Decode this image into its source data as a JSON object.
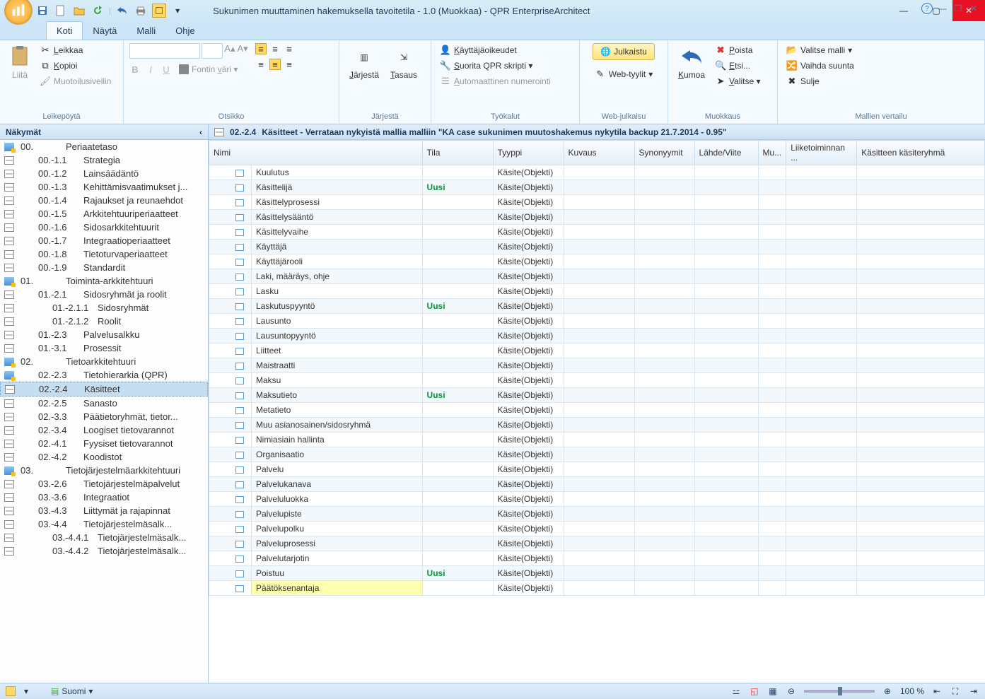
{
  "window": {
    "title": "Sukunimen muuttaminen hakemuksella tavoitetila - 1.0 (Muokkaa) - QPR EnterpriseArchitect"
  },
  "ribbon_tabs": [
    "Koti",
    "Näytä",
    "Malli",
    "Ohje"
  ],
  "ribbon": {
    "group_clipboard": {
      "label": "Leikepöytä",
      "paste": "Liitä",
      "cut": "Leikkaa",
      "copy": "Kopioi",
      "fmt": "Muotoilusivellin"
    },
    "group_title": {
      "label": "Otsikko",
      "fontcolor": "Fontin väri"
    },
    "group_arrange": {
      "label": "Järjestä",
      "sort": "Järjestä",
      "align": "Tasaus"
    },
    "group_tools": {
      "label": "Työkalut",
      "perm": "Käyttäjäoikeudet",
      "script": "Suorita QPR skripti",
      "autonum": "Automaattinen numerointi"
    },
    "group_web": {
      "label": "Web-julkaisu",
      "publish": "Julkaistu",
      "styles": "Web-tyylit"
    },
    "group_edit": {
      "label": "Muokkaus",
      "undo": "Kumoa",
      "delete": "Poista",
      "find": "Etsi...",
      "select": "Valitse"
    },
    "group_compare": {
      "label": "Mallien vertailu",
      "choose": "Valitse malli",
      "dir": "Vaihda suunta",
      "close": "Sulje"
    }
  },
  "nav": {
    "title": "Näkymät",
    "items": [
      {
        "icon": "folder",
        "code": "00.",
        "label": "Periaatetaso",
        "lvl": 1
      },
      {
        "icon": "grid",
        "code": "00.-1.1",
        "label": "Strategia",
        "lvl": 2
      },
      {
        "icon": "grid",
        "code": "00.-1.2",
        "label": "Lainsäädäntö",
        "lvl": 2
      },
      {
        "icon": "grid",
        "code": "00.-1.3",
        "label": "Kehittämisvaatimukset j...",
        "lvl": 2
      },
      {
        "icon": "grid",
        "code": "00.-1.4",
        "label": "Rajaukset ja reunaehdot",
        "lvl": 2
      },
      {
        "icon": "grid",
        "code": "00.-1.5",
        "label": "Arkkitehtuuriperiaatteet",
        "lvl": 2
      },
      {
        "icon": "grid",
        "code": "00.-1.6",
        "label": "Sidosarkkitehtuurit",
        "lvl": 2
      },
      {
        "icon": "grid",
        "code": "00.-1.7",
        "label": "Integraatioperiaatteet",
        "lvl": 2
      },
      {
        "icon": "grid",
        "code": "00.-1.8",
        "label": "Tietoturvaperiaatteet",
        "lvl": 2
      },
      {
        "icon": "grid",
        "code": "00.-1.9",
        "label": "Standardit",
        "lvl": 2
      },
      {
        "icon": "folder",
        "code": "01.",
        "label": "Toiminta-arkkitehtuuri",
        "lvl": 1
      },
      {
        "icon": "grid",
        "code": "01.-2.1",
        "label": "Sidosryhmät ja roolit",
        "lvl": 2
      },
      {
        "icon": "grid",
        "code": "01.-2.1.1",
        "label": "Sidosryhmät",
        "lvl": 3
      },
      {
        "icon": "grid",
        "code": "01.-2.1.2",
        "label": "Roolit",
        "lvl": 3
      },
      {
        "icon": "grid",
        "code": "01.-2.3",
        "label": "Palvelusalkku",
        "lvl": 2
      },
      {
        "icon": "grid",
        "code": "01.-3.1",
        "label": "Prosessit",
        "lvl": 2
      },
      {
        "icon": "folder",
        "code": "02.",
        "label": "Tietoarkkitehtuuri",
        "lvl": 1
      },
      {
        "icon": "folder",
        "code": "02.-2.3",
        "label": "Tietohierarkia (QPR)",
        "lvl": 2
      },
      {
        "icon": "grid",
        "code": "02.-2.4",
        "label": "Käsitteet",
        "lvl": 2,
        "sel": true
      },
      {
        "icon": "grid",
        "code": "02.-2.5",
        "label": "Sanasto",
        "lvl": 2
      },
      {
        "icon": "grid",
        "code": "02.-3.3",
        "label": "Päätietoryhmät, tietor...",
        "lvl": 2
      },
      {
        "icon": "grid",
        "code": "02.-3.4",
        "label": "Loogiset tietovarannot",
        "lvl": 2
      },
      {
        "icon": "grid",
        "code": "02.-4.1",
        "label": "Fyysiset tietovarannot",
        "lvl": 2
      },
      {
        "icon": "grid",
        "code": "02.-4.2",
        "label": "Koodistot",
        "lvl": 2
      },
      {
        "icon": "folder",
        "code": "03.",
        "label": "Tietojärjestelmäarkkitehtuuri",
        "lvl": 1
      },
      {
        "icon": "grid",
        "code": "03.-2.6",
        "label": "Tietojärjestelmäpalvelut",
        "lvl": 2
      },
      {
        "icon": "grid",
        "code": "03.-3.6",
        "label": "Integraatiot",
        "lvl": 2
      },
      {
        "icon": "grid",
        "code": "03.-4.3",
        "label": "Liittymät ja rajapinnat",
        "lvl": 2
      },
      {
        "icon": "grid",
        "code": "03.-4.4",
        "label": "Tietojärjestelmäsalk...",
        "lvl": 2
      },
      {
        "icon": "grid",
        "code": "03.-4.4.1",
        "label": "Tietojärjestelmäsalk...",
        "lvl": 3
      },
      {
        "icon": "grid",
        "code": "03.-4.4.2",
        "label": "Tietojärjestelmäsalk...",
        "lvl": 3
      }
    ]
  },
  "content": {
    "header_code": "02.-2.4",
    "header_text": "Käsitteet - Verrataan nykyistä mallia malliin \"KA case sukunimen muutoshakemus nykytila backup 21.7.2014 - 0.95\"",
    "columns": [
      "Nimi",
      "Tila",
      "Tyyppi",
      "Kuvaus",
      "Synonyymit",
      "Lähde/Viite",
      "Mu...",
      "Liiketoiminnan ...",
      "Käsitteen käsiteryhmä"
    ],
    "rows": [
      {
        "n": "Kuulutus",
        "t": "",
        "y": "Käsite(Objekti)"
      },
      {
        "n": "Käsittelijä",
        "t": "Uusi",
        "y": "Käsite(Objekti)"
      },
      {
        "n": "Käsittelyprosessi",
        "t": "",
        "y": "Käsite(Objekti)"
      },
      {
        "n": "Käsittelysääntö",
        "t": "",
        "y": "Käsite(Objekti)"
      },
      {
        "n": "Käsittelyvaihe",
        "t": "",
        "y": "Käsite(Objekti)"
      },
      {
        "n": "Käyttäjä",
        "t": "",
        "y": "Käsite(Objekti)"
      },
      {
        "n": "Käyttäjärooli",
        "t": "",
        "y": "Käsite(Objekti)"
      },
      {
        "n": "Laki, määräys, ohje",
        "t": "",
        "y": "Käsite(Objekti)"
      },
      {
        "n": "Lasku",
        "t": "",
        "y": "Käsite(Objekti)"
      },
      {
        "n": "Laskutuspyyntö",
        "t": "Uusi",
        "y": "Käsite(Objekti)"
      },
      {
        "n": "Lausunto",
        "t": "",
        "y": "Käsite(Objekti)"
      },
      {
        "n": "Lausuntopyyntö",
        "t": "",
        "y": "Käsite(Objekti)"
      },
      {
        "n": "Liitteet",
        "t": "",
        "y": "Käsite(Objekti)"
      },
      {
        "n": "Maistraatti",
        "t": "",
        "y": "Käsite(Objekti)"
      },
      {
        "n": "Maksu",
        "t": "",
        "y": "Käsite(Objekti)"
      },
      {
        "n": "Maksutieto",
        "t": "Uusi",
        "y": "Käsite(Objekti)"
      },
      {
        "n": "Metatieto",
        "t": "",
        "y": "Käsite(Objekti)"
      },
      {
        "n": "Muu asianosainen/sidosryhmä",
        "t": "",
        "y": "Käsite(Objekti)"
      },
      {
        "n": "Nimiasiain hallinta",
        "t": "",
        "y": "Käsite(Objekti)"
      },
      {
        "n": "Organisaatio",
        "t": "",
        "y": "Käsite(Objekti)"
      },
      {
        "n": "Palvelu",
        "t": "",
        "y": "Käsite(Objekti)"
      },
      {
        "n": "Palvelukanava",
        "t": "",
        "y": "Käsite(Objekti)"
      },
      {
        "n": "Palveluluokka",
        "t": "",
        "y": "Käsite(Objekti)"
      },
      {
        "n": "Palvelupiste",
        "t": "",
        "y": "Käsite(Objekti)"
      },
      {
        "n": "Palvelupolku",
        "t": "",
        "y": "Käsite(Objekti)"
      },
      {
        "n": "Palveluprosessi",
        "t": "",
        "y": "Käsite(Objekti)"
      },
      {
        "n": "Palvelutarjotin",
        "t": "",
        "y": "Käsite(Objekti)"
      },
      {
        "n": "Poistuu",
        "t": "Uusi",
        "y": "Käsite(Objekti)"
      },
      {
        "n": "Päätöksenantaja",
        "t": "",
        "y": "Käsite(Objekti)",
        "hl": true
      }
    ]
  },
  "status": {
    "lang": "Suomi",
    "zoom": "100 %"
  }
}
